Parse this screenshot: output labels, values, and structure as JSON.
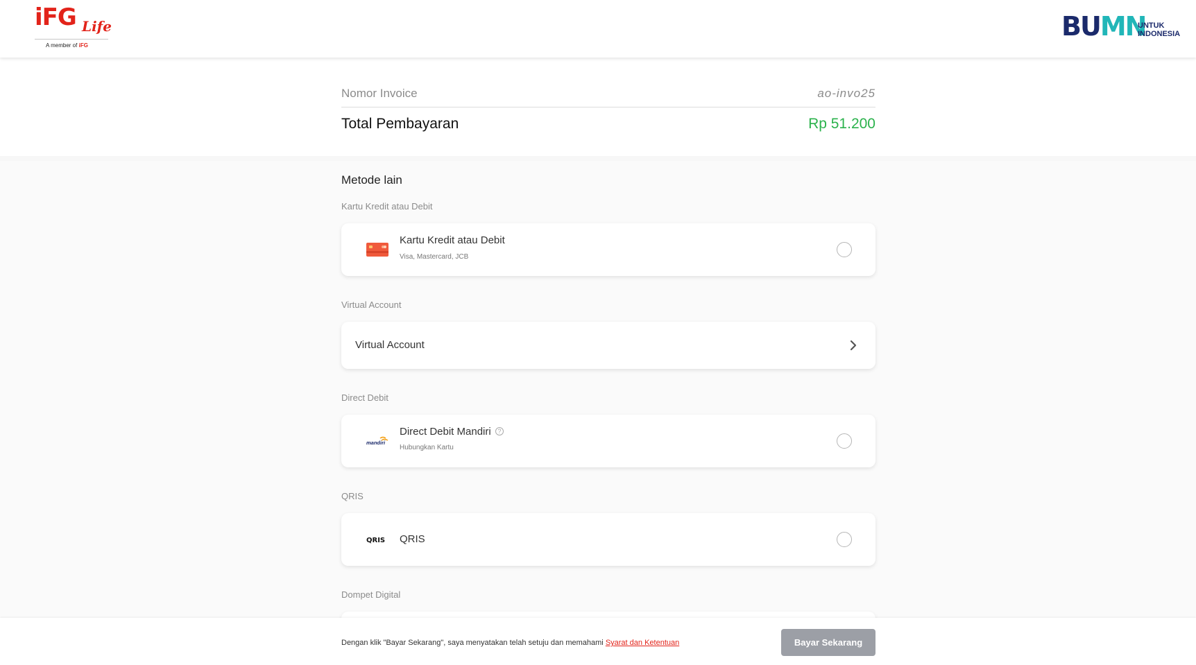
{
  "header": {
    "brand_main": "iFG",
    "brand_sub": "Life",
    "member_text": "A member of",
    "member_brand": "iFG",
    "partner_word_1": "BU",
    "partner_word_2": "MN",
    "partner_tagline_1": "UNTUK",
    "partner_tagline_2": "INDONESIA"
  },
  "invoice": {
    "number_label": "Nomor Invoice",
    "number_value": "ao-invo25",
    "total_label": "Total Pembayaran",
    "total_value": "Rp 51.200",
    "total_color": "#2bb24c"
  },
  "methods": {
    "title": "Metode lain",
    "card_section_label": "Kartu Kredit atau Debit",
    "card_title": "Kartu Kredit atau Debit",
    "card_subtitle": "Visa, Mastercard, JCB",
    "va_section_label": "Virtual Account",
    "va_title": "Virtual Account",
    "dd_section_label": "Direct Debit",
    "dd_title": "Direct Debit Mandiri",
    "dd_subtitle": "Hubungkan Kartu",
    "dd_logo_text": "mandiri",
    "qris_section_label": "QRIS",
    "qris_title": "QRIS",
    "qris_logo_text": "QRIS",
    "wallet_section_label": "Dompet Digital",
    "icons": {
      "card": "credit-card-icon",
      "va_chevron": "chevron-right-icon",
      "help": "help-icon",
      "mandiri": "mandiri-logo",
      "qris": "qris-logo"
    }
  },
  "footer": {
    "terms_prefix": "Dengan klik \"Bayar Sekarang\", saya menyatakan telah setuju dan memahami",
    "terms_link": "Syarat dan Ketentuan",
    "pay_button": "Bayar Sekarang"
  },
  "colors": {
    "brand_red": "#e2231a",
    "bumn_navy": "#1b2a6b",
    "bumn_teal": "#21b6b8",
    "button_disabled": "#9c9fa6"
  }
}
